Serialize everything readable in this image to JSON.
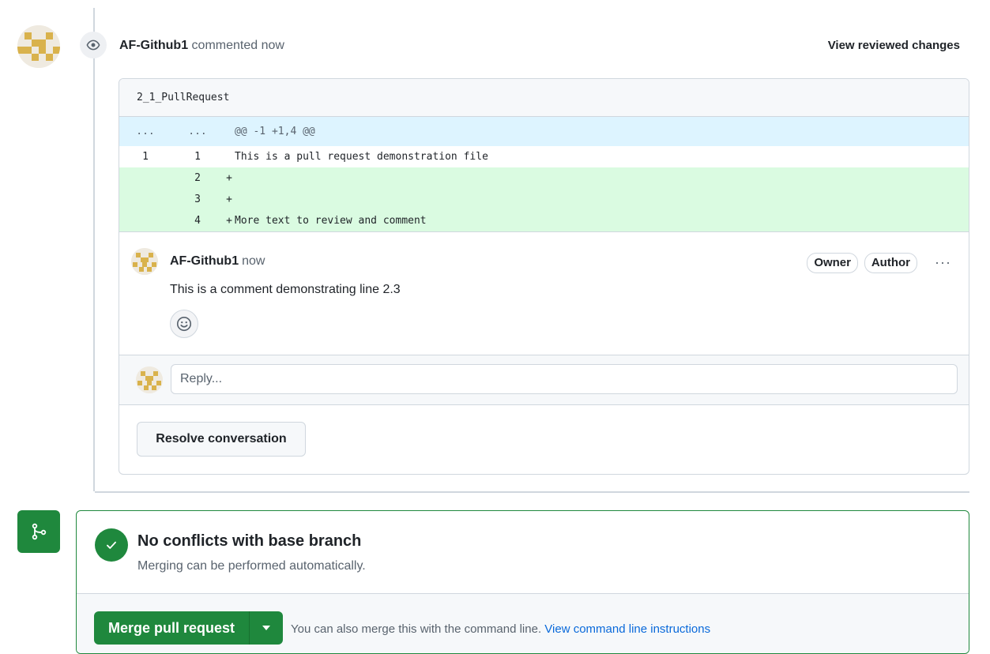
{
  "review": {
    "author": "AF-Github1",
    "action": "commented now",
    "view_reviewed_label": "View reviewed changes"
  },
  "file": {
    "name": "2_1_PullRequest",
    "hunk": {
      "old": "...",
      "new": "...",
      "text": "@@ -1 +1,4 @@"
    },
    "lines": [
      {
        "old": "1",
        "new": "1",
        "type": "context",
        "marker": "",
        "text": "This is a pull request demonstration file"
      },
      {
        "old": "",
        "new": "2",
        "type": "add",
        "marker": "+",
        "text": ""
      },
      {
        "old": "",
        "new": "3",
        "type": "add",
        "marker": "+",
        "text": ""
      },
      {
        "old": "",
        "new": "4",
        "type": "add",
        "marker": "+",
        "text": "More text to review and comment"
      }
    ]
  },
  "comment": {
    "author": "AF-Github1",
    "time": "now",
    "body": "This is a comment demonstrating line 2.3",
    "badges": [
      "Owner",
      "Author"
    ],
    "more_icon": "kebab-horizontal-icon",
    "reaction_icon": "smiley-icon"
  },
  "reply": {
    "placeholder": "Reply..."
  },
  "resolve_label": "Resolve conversation",
  "merge": {
    "title": "No conflicts with base branch",
    "subtitle": "Merging can be performed automatically.",
    "button_label": "Merge pull request",
    "hint_text": "You can also merge this with the command line.",
    "hint_link": "View command line instructions",
    "accent_color": "#1f883d"
  }
}
